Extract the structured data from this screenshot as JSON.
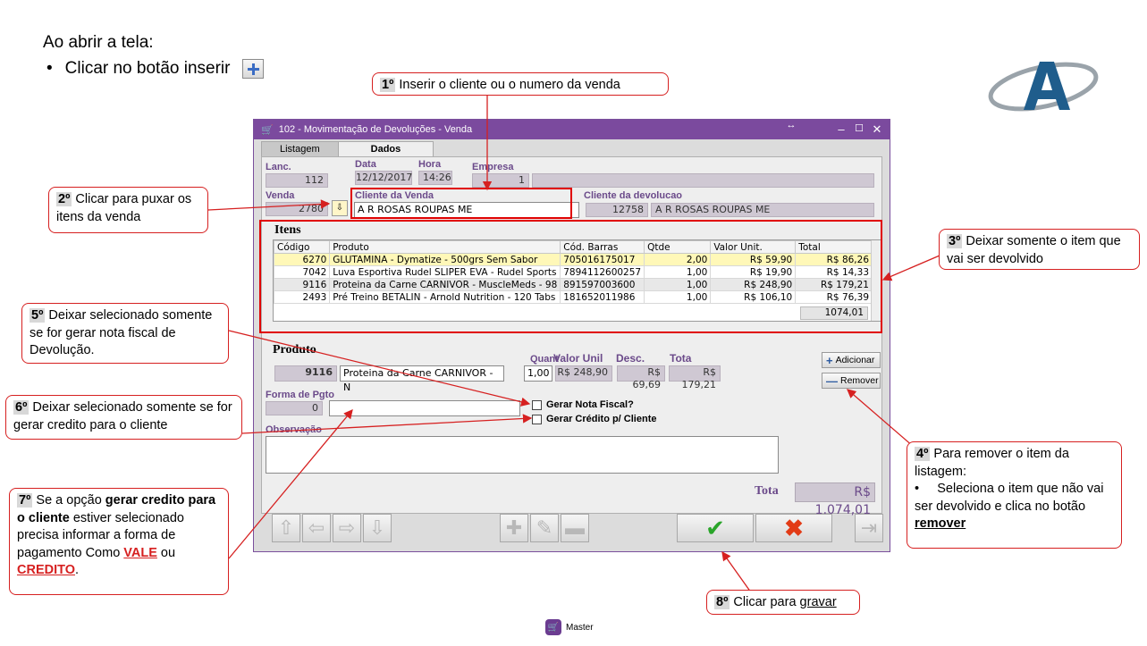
{
  "intro": {
    "line1": "Ao abrir a tela:",
    "line2": "Clicar no botão inserir"
  },
  "callouts": {
    "c1_num": "1º",
    "c1_text": " Inserir o cliente ou o numero da venda",
    "c2_num": "2º",
    "c2_text": " Clicar para puxar os itens da venda",
    "c3_num": "3º",
    "c3_text": " Deixar somente o item que vai ser devolvido",
    "c4_num": "4º",
    "c4_text": " Para remover o item da listagem:",
    "c4_bullet": "Seleciona o item que não vai ser devolvido e clica no botão ",
    "c4_strong": "remover",
    "c5_num": "5º",
    "c5_text": " Deixar selecionado somente  se for gerar nota fiscal de Devolução.",
    "c6_num": "6º",
    "c6_text": " Deixar selecionado somente se for gerar credito para o cliente",
    "c7_num": "7º",
    "c7_pre": " Se a opção ",
    "c7_bold": "gerar credito para o cliente",
    "c7_mid": " estiver selecionado precisa informar a forma de pagamento Como ",
    "c7_vale": "VALE",
    "c7_or": " ou ",
    "c7_credito": "CREDITO",
    "c7_end": ".",
    "c8_num": "8º",
    "c8_text": " Clicar para ",
    "c8_link": "gravar"
  },
  "window": {
    "title": "102 - Movimentação de Devoluções - Venda",
    "tabs": [
      "Listagem",
      "Dados"
    ]
  },
  "form": {
    "lanc_label": "Lanc.",
    "lanc_value": "112",
    "data_label": "Data",
    "data_value": "12/12/2017",
    "hora_label": "Hora",
    "hora_value": "14:26",
    "empresa_label": "Empresa",
    "empresa_value": "1",
    "venda_label": "Venda",
    "venda_value": "2780",
    "cliente_venda_label": "Cliente da Venda",
    "cliente_venda_value": "A R ROSAS ROUPAS ME",
    "cliente_dev_label": "Cliente da devolucao",
    "cliente_dev_code": "12758",
    "cliente_dev_name": "A R ROSAS ROUPAS ME"
  },
  "itens": {
    "title": "Itens",
    "columns": [
      "Código",
      "Produto",
      "Cód. Barras",
      "Qtde",
      "Valor Unit.",
      "Total"
    ],
    "rows": [
      {
        "codigo": "6270",
        "produto": "GLUTAMINA - Dymatize - 500grs Sem Sabor",
        "barras": "705016175017",
        "qtde": "2,00",
        "valor": "R$ 59,90",
        "total": "R$ 86,26"
      },
      {
        "codigo": "7042",
        "produto": "Luva Esportiva Rudel SLIPER EVA - Rudel Sports",
        "barras": "7894112600257",
        "qtde": "1,00",
        "valor": "R$ 19,90",
        "total": "R$ 14,33"
      },
      {
        "codigo": "9116",
        "produto": "Proteina da Carne CARNIVOR - MuscleMeds - 98",
        "barras": "891597003600",
        "qtde": "1,00",
        "valor": "R$ 248,90",
        "total": "R$ 179,21"
      },
      {
        "codigo": "2493",
        "produto": "Pré Treino BETALIN - Arnold Nutrition - 120 Tabs",
        "barras": "181652011986",
        "qtde": "1,00",
        "valor": "R$ 106,10",
        "total": "R$ 76,39"
      }
    ],
    "grand_total": "1074,01"
  },
  "produto": {
    "title": "Produto",
    "codigo": "9116",
    "nome": "Proteina da Carne CARNIVOR - N",
    "quant_label": "Quant",
    "quant_value": "1,00",
    "valor_label": "Valor Unil",
    "valor_value": "R$ 248,90",
    "desc_label": "Desc.",
    "desc_value": "R$ 69,69",
    "total_label": "Tota",
    "total_value": "R$ 179,21",
    "add_label": "Adicionar",
    "remove_label": "Remover"
  },
  "pagamento": {
    "forma_label": "Forma de Pgto",
    "forma_code": "0",
    "nota_fiscal_label": "Gerar Nota Fiscal?",
    "credito_label": "Gerar Crédito p/ Cliente",
    "obs_label": "Observação"
  },
  "totais": {
    "label": "Tota",
    "value": "R$ 1.074,01"
  },
  "footer": {
    "brand": "Master"
  }
}
